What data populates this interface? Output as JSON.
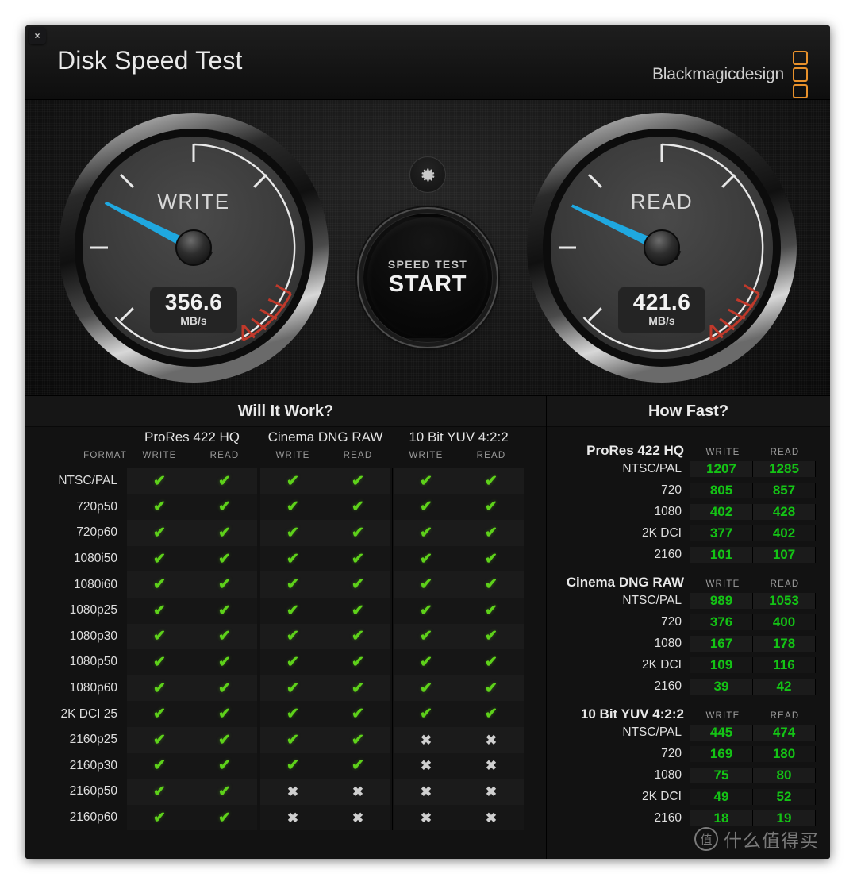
{
  "window": {
    "title": "Disk Speed Test",
    "close_label": "×",
    "brand": "Blackmagicdesign"
  },
  "gauges": {
    "settings_icon": "gear-icon",
    "write": {
      "label": "WRITE",
      "value": "356.6",
      "unit": "MB/s"
    },
    "read": {
      "label": "READ",
      "value": "421.6",
      "unit": "MB/s"
    },
    "start_button": {
      "line1": "SPEED TEST",
      "line2": "START"
    },
    "colors": {
      "needle": "#1fa8e0",
      "redline": "#c0392b",
      "dial": "#3a3a3a"
    }
  },
  "will_it_work": {
    "title": "Will It Work?",
    "format_column_label": "FORMAT",
    "groups": [
      {
        "name": "ProRes 422 HQ",
        "sub": [
          "WRITE",
          "READ"
        ]
      },
      {
        "name": "Cinema DNG RAW",
        "sub": [
          "WRITE",
          "READ"
        ]
      },
      {
        "name": "10 Bit YUV 4:2:2",
        "sub": [
          "WRITE",
          "READ"
        ]
      }
    ],
    "ok_mark": "✔",
    "no_mark": "✖",
    "rows": [
      {
        "format": "NTSC/PAL",
        "cells": [
          true,
          true,
          true,
          true,
          true,
          true
        ]
      },
      {
        "format": "720p50",
        "cells": [
          true,
          true,
          true,
          true,
          true,
          true
        ]
      },
      {
        "format": "720p60",
        "cells": [
          true,
          true,
          true,
          true,
          true,
          true
        ]
      },
      {
        "format": "1080i50",
        "cells": [
          true,
          true,
          true,
          true,
          true,
          true
        ]
      },
      {
        "format": "1080i60",
        "cells": [
          true,
          true,
          true,
          true,
          true,
          true
        ]
      },
      {
        "format": "1080p25",
        "cells": [
          true,
          true,
          true,
          true,
          true,
          true
        ]
      },
      {
        "format": "1080p30",
        "cells": [
          true,
          true,
          true,
          true,
          true,
          true
        ]
      },
      {
        "format": "1080p50",
        "cells": [
          true,
          true,
          true,
          true,
          true,
          true
        ]
      },
      {
        "format": "1080p60",
        "cells": [
          true,
          true,
          true,
          true,
          true,
          true
        ]
      },
      {
        "format": "2K DCI 25",
        "cells": [
          true,
          true,
          true,
          true,
          true,
          true
        ]
      },
      {
        "format": "2160p25",
        "cells": [
          true,
          true,
          true,
          true,
          false,
          false
        ]
      },
      {
        "format": "2160p30",
        "cells": [
          true,
          true,
          true,
          true,
          false,
          false
        ]
      },
      {
        "format": "2160p50",
        "cells": [
          true,
          true,
          false,
          false,
          false,
          false
        ]
      },
      {
        "format": "2160p60",
        "cells": [
          true,
          true,
          false,
          false,
          false,
          false
        ]
      }
    ]
  },
  "how_fast": {
    "title": "How Fast?",
    "col_write": "WRITE",
    "col_read": "READ",
    "sections": [
      {
        "name": "ProRes 422 HQ",
        "rows": [
          {
            "format": "NTSC/PAL",
            "write": "1207",
            "read": "1285"
          },
          {
            "format": "720",
            "write": "805",
            "read": "857"
          },
          {
            "format": "1080",
            "write": "402",
            "read": "428"
          },
          {
            "format": "2K DCI",
            "write": "377",
            "read": "402"
          },
          {
            "format": "2160",
            "write": "101",
            "read": "107"
          }
        ]
      },
      {
        "name": "Cinema DNG RAW",
        "rows": [
          {
            "format": "NTSC/PAL",
            "write": "989",
            "read": "1053"
          },
          {
            "format": "720",
            "write": "376",
            "read": "400"
          },
          {
            "format": "1080",
            "write": "167",
            "read": "178"
          },
          {
            "format": "2K DCI",
            "write": "109",
            "read": "116"
          },
          {
            "format": "2160",
            "write": "39",
            "read": "42"
          }
        ]
      },
      {
        "name": "10 Bit YUV 4:2:2",
        "rows": [
          {
            "format": "NTSC/PAL",
            "write": "445",
            "read": "474"
          },
          {
            "format": "720",
            "write": "169",
            "read": "180"
          },
          {
            "format": "1080",
            "write": "75",
            "read": "80"
          },
          {
            "format": "2K DCI",
            "write": "49",
            "read": "52"
          },
          {
            "format": "2160",
            "write": "18",
            "read": "19"
          }
        ]
      }
    ]
  },
  "watermark": {
    "badge": "值",
    "text": "什么值得买"
  }
}
